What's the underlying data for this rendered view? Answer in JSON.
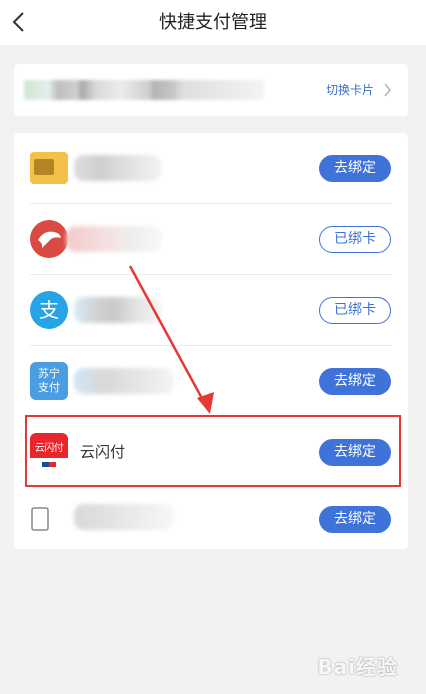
{
  "header": {
    "title": "快捷支付管理",
    "back_icon": "chevron-left-icon"
  },
  "account": {
    "switch_label": "切换卡片",
    "switch_icon": "chevron-right-icon"
  },
  "rows": [
    {
      "icon": "card-icon",
      "name": "",
      "action": "去绑定",
      "action_style": "solid"
    },
    {
      "icon": "bank-logo-icon",
      "name": "",
      "action": "已绑卡",
      "action_style": "outline"
    },
    {
      "icon": "alipay-icon",
      "name": "",
      "action": "已绑卡",
      "action_style": "outline"
    },
    {
      "icon": "suning-pay-icon",
      "name": "",
      "action": "去绑定",
      "action_style": "solid"
    },
    {
      "icon": "unionpay-quickpass-icon",
      "name": "云闪付",
      "action": "去绑定",
      "action_style": "solid"
    },
    {
      "icon": "card-icon",
      "name": "",
      "action": "去绑定",
      "action_style": "solid"
    }
  ],
  "icon_texts": {
    "alipay": "支",
    "suning": [
      "苏宁",
      "支付"
    ],
    "quickpass": "云闪付"
  },
  "colors": {
    "accent": "#3f73da",
    "highlight": "#e53935",
    "quickpass_red": "#e8262c"
  },
  "watermark": "Bai经验"
}
